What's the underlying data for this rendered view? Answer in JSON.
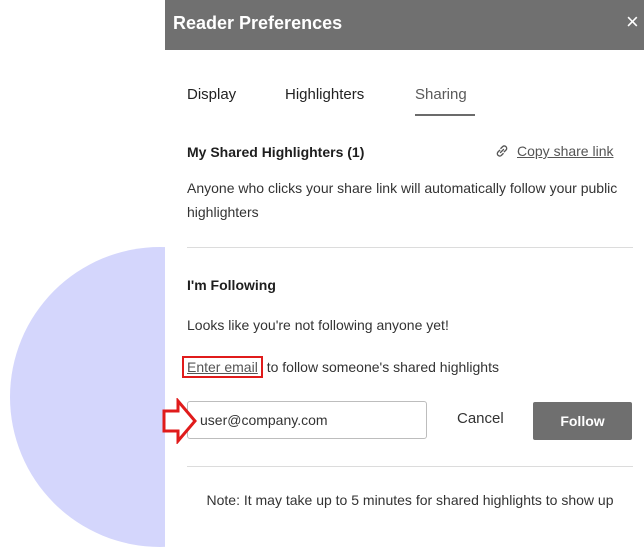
{
  "dialog": {
    "title": "Reader Preferences",
    "close_label": "×"
  },
  "tabs": [
    {
      "label": "Display",
      "active": false
    },
    {
      "label": "Highlighters",
      "active": false
    },
    {
      "label": "Sharing",
      "active": true
    }
  ],
  "shared_section": {
    "heading": "My Shared Highlighters (1)",
    "copy_link_label": "Copy share link",
    "copy_link_icon": "link-icon",
    "description": "Anyone who clicks your share link will automatically follow your public highlighters"
  },
  "following_section": {
    "heading": "I'm Following",
    "empty_message": "Looks like you're not following anyone yet!",
    "enter_email_link": "Enter email",
    "enter_email_suffix": " to follow someone's shared highlights",
    "email_input_value": "user@company.com",
    "cancel_label": "Cancel",
    "follow_label": "Follow"
  },
  "note": "Note: It may take up to 5 minutes for shared highlights to show up",
  "colors": {
    "titlebar": "#707070",
    "follow_button": "#6f6f6f",
    "annotation_red": "#e01b1b",
    "background_circle": "#d4d6fc"
  }
}
